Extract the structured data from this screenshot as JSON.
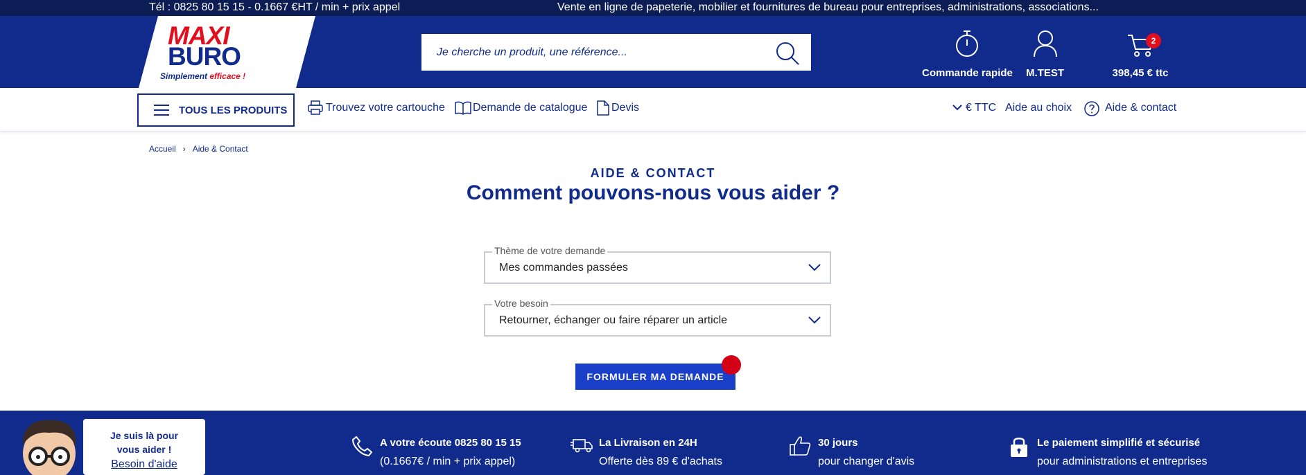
{
  "topbar": {
    "phone": "Tél : 0825 80 15 15 - 0.1667 €HT / min + prix appel",
    "tagline": "Vente en ligne de papeterie, mobilier et fournitures de bureau pour entreprises, administrations, associations..."
  },
  "header": {
    "logo": {
      "line1": "MAXI",
      "line2": "BURO",
      "slogan_a": "Simplement ",
      "slogan_b": "efficace !"
    },
    "search": {
      "placeholder": "Je cherche un produit, une référence..."
    },
    "quick_order": "Commande rapide",
    "user": "M.TEST",
    "cart": {
      "total": "398,45 € ttc",
      "count": "2"
    }
  },
  "nav": {
    "all_products": "TOUS LES PRODUITS",
    "cartridge": "Trouvez votre cartouche",
    "catalog": "Demande de catalogue",
    "quote": "Devis",
    "currency": "€ TTC",
    "choice_help": "Aide au choix",
    "help_contact": "Aide & contact"
  },
  "breadcrumb": [
    "Accueil",
    "Aide & Contact"
  ],
  "main": {
    "kicker": "AIDE & CONTACT",
    "title": "Comment pouvons-nous vous aider ?",
    "field1": {
      "legend": "Thème de votre demande",
      "value": "Mes commandes passées"
    },
    "field2": {
      "legend": "Votre besoin",
      "value": "Retourner, échanger ou faire réparer un article"
    },
    "submit": "FORMULER MA DEMANDE"
  },
  "footer": {
    "help": {
      "line1": "Je suis là pour",
      "line2": "vous aider !",
      "link": "Besoin d'aide"
    },
    "features": [
      {
        "title": "A votre écoute 0825 80 15 15",
        "sub": "(0.1667€ / min + prix appel)",
        "icon": "phone-icon"
      },
      {
        "title": "La Livraison en 24H",
        "sub": "Offerte dès 89 € d'achats",
        "icon": "truck-icon"
      },
      {
        "title": "30 jours",
        "sub": "pour changer d'avis",
        "icon": "thumbs-up-icon"
      },
      {
        "title": "Le paiement simplifié et sécurisé",
        "sub": "pour administrations et entreprises",
        "icon": "lock-icon"
      }
    ]
  },
  "colors": {
    "navy": "#102b8c",
    "dark": "#0c1c55",
    "red": "#e10e1e",
    "button": "#1a3fc8"
  }
}
